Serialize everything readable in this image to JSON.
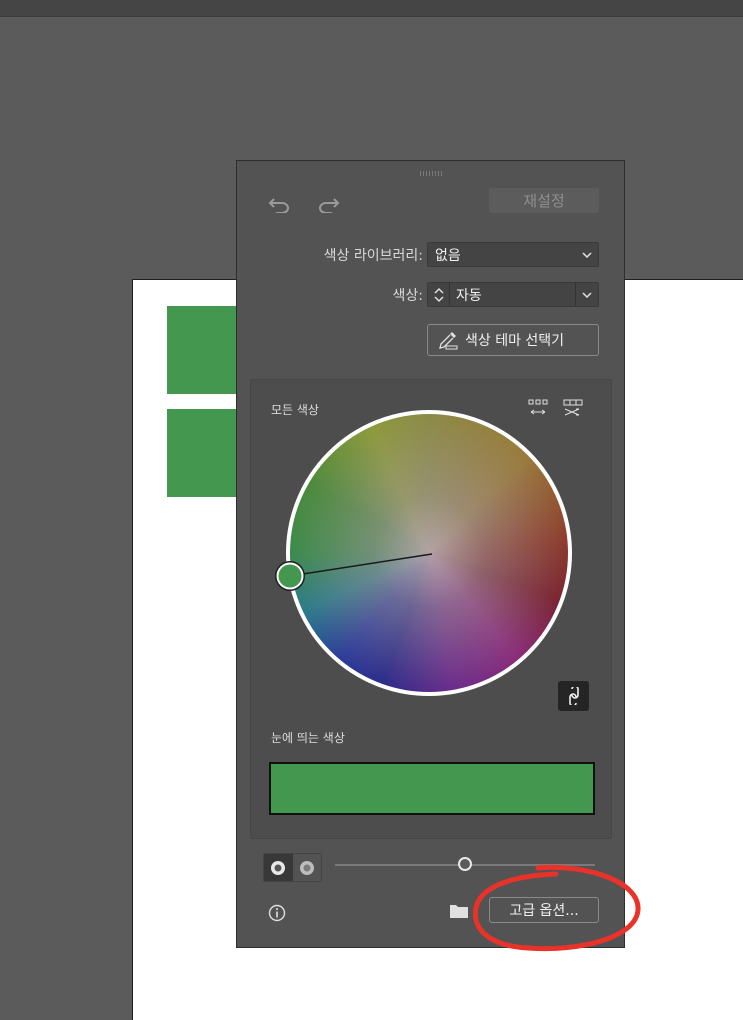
{
  "panel": {
    "reset_label": "재설정",
    "library_label": "색상 라이브러리:",
    "library_value": "없음",
    "colors_label": "색상:",
    "colors_value": "자동",
    "theme_picker_label": "색상 테마 선택기",
    "all_colors_label": "모든 색상",
    "prominent_colors_label": "눈에 띄는 색상",
    "advanced_options_label": "고급 옵션...",
    "prominent_color": "#43974f",
    "selected_color": "#43974f",
    "hue_slider_value": 0.5
  },
  "icons": {
    "undo": "undo-icon",
    "redo": "redo-icon",
    "eyedropper": "eyedropper-icon",
    "arrange": "arrange-colors-icon",
    "shuffle": "shuffle-colors-icon",
    "link": "link-icon",
    "info": "info-icon",
    "folder": "folder-icon"
  },
  "colors": {
    "panel_bg": "#535353",
    "canvas_bg": "#5b5b5b",
    "artboard": "#ffffff",
    "annotation": "#e8322a"
  }
}
